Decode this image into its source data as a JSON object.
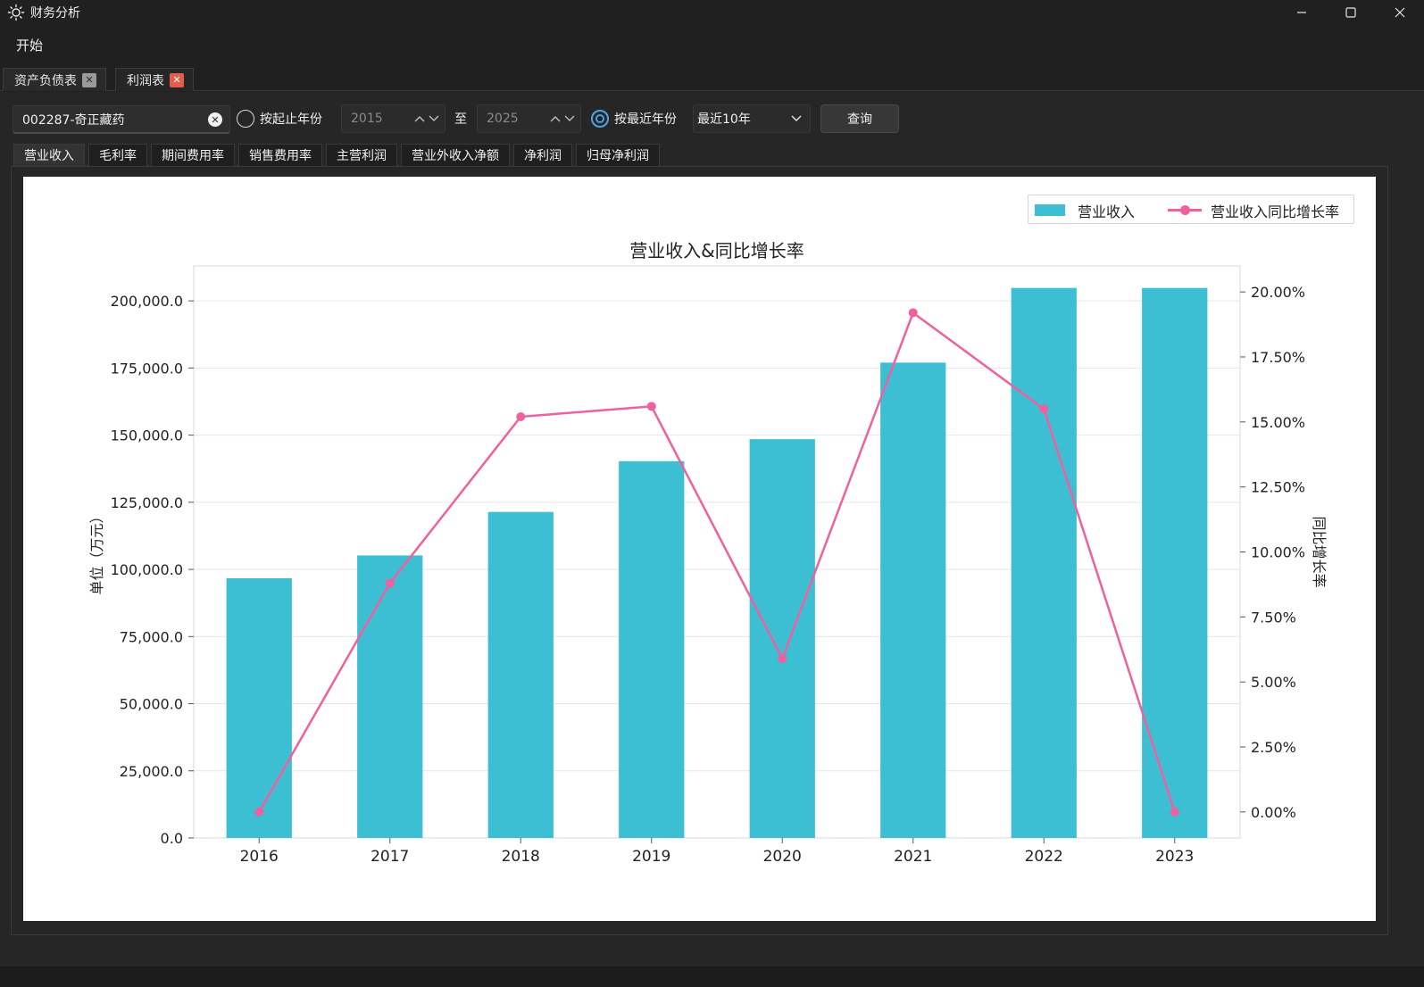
{
  "window": {
    "title": "财务分析",
    "controls": [
      "minimize",
      "maximize",
      "close"
    ]
  },
  "menu": {
    "items": [
      "开始"
    ]
  },
  "doc_tabs": [
    {
      "label": "资产负债表",
      "active": false
    },
    {
      "label": "利润表",
      "active": true
    }
  ],
  "toolbar": {
    "stock": "002287-奇正藏药",
    "radio_range_label": "按起止年份",
    "start_year": "2015",
    "to_label": "至",
    "end_year": "2025",
    "radio_recent_label": "按最近年份",
    "recent_selected": "最近10年",
    "query_label": "查询"
  },
  "metric_tabs": [
    "营业收入",
    "毛利率",
    "期间费用率",
    "销售费用率",
    "主营利润",
    "营业外收入净额",
    "净利润",
    "归母净利润"
  ],
  "colors": {
    "bar": "#3dbfd3",
    "line": "#f0609e",
    "accent": "#4aa3e8"
  },
  "chart_data": {
    "type": "bar",
    "title": "营业收入&同比增长率",
    "categories": [
      "2016",
      "2017",
      "2018",
      "2019",
      "2020",
      "2021",
      "2022",
      "2023"
    ],
    "series": [
      {
        "name": "营业收入",
        "type": "bar",
        "axis": "left",
        "values": [
          96700,
          105200,
          121400,
          140300,
          148500,
          177000,
          204800,
          204800
        ]
      },
      {
        "name": "营业收入同比增长率",
        "type": "line",
        "axis": "right",
        "values": [
          0.0,
          8.8,
          15.2,
          15.6,
          5.9,
          19.2,
          15.5,
          0.0
        ]
      }
    ],
    "ylabel": "单位（万元）",
    "y2label": "同比增长率",
    "ylim": [
      0,
      213000
    ],
    "y2lim": [
      -1.0,
      21.0
    ],
    "yticks": [
      0,
      25000,
      50000,
      75000,
      100000,
      125000,
      150000,
      175000,
      200000
    ],
    "ytick_labels": [
      "0.0",
      "25,000.0",
      "50,000.0",
      "75,000.0",
      "100,000.0",
      "125,000.0",
      "150,000.0",
      "175,000.0",
      "200,000.0"
    ],
    "y2ticks": [
      0,
      2.5,
      5,
      7.5,
      10,
      12.5,
      15,
      17.5,
      20
    ],
    "y2tick_labels": [
      "0.00%",
      "2.50%",
      "5.00%",
      "7.50%",
      "10.00%",
      "12.50%",
      "15.00%",
      "17.50%",
      "20.00%"
    ],
    "grid": true,
    "legend": "top-right"
  }
}
